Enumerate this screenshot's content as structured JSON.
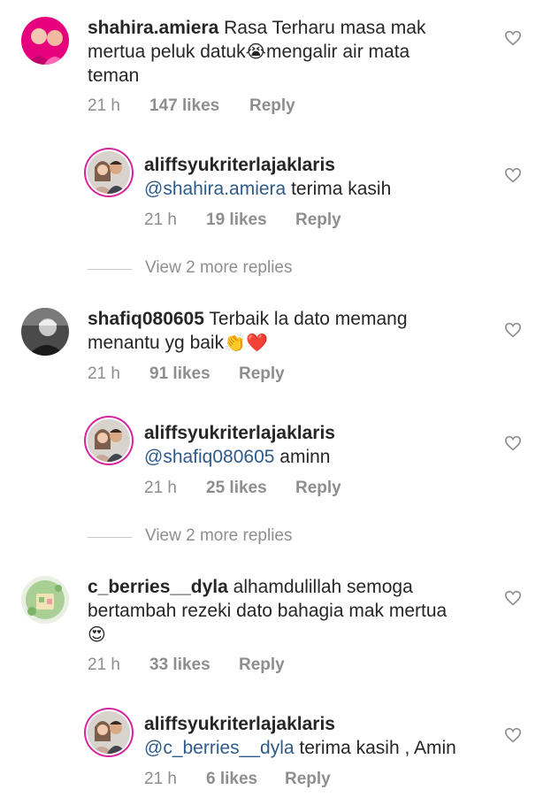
{
  "comments": [
    {
      "username": "shahira.amiera",
      "text_line1": "Rasa Terharu masa mak",
      "text_line2": "mertua peluk datuk",
      "emoji2": "😭",
      "text_line2b": "mengalir air mata",
      "text_line3": "teman",
      "time": "21 h",
      "likes": "147 likes",
      "reply": "Reply",
      "avatar_colors": [
        "#e6007e",
        "#f4c2c2"
      ]
    },
    {
      "username": "shafiq080605",
      "text_line1": "Terbaik la dato memang",
      "text_line2": "menantu yg baik",
      "emoji2": "👏❤️",
      "time": "21 h",
      "likes": "91 likes",
      "reply": "Reply",
      "avatar_colors": [
        "#3a3a3a",
        "#b0b0b0"
      ]
    },
    {
      "username": "c_berries__dyla",
      "text_line1": "alhamdulillah semoga",
      "text_line2": "bertambah rezeki dato bahagia mak mertua",
      "text_line3": "😍",
      "time": "21 h",
      "likes": "33 likes",
      "reply": "Reply",
      "avatar_colors": [
        "#9bc48f",
        "#f0e4c8"
      ]
    }
  ],
  "replies": [
    {
      "username": "aliffsyukriterlajaklaris",
      "mention": "@shahira.amiera",
      "text": "terima kasih",
      "time": "21 h",
      "likes": "19 likes",
      "reply": "Reply"
    },
    {
      "username": "aliffsyukriterlajaklaris",
      "mention": "@shafiq080605",
      "text": "aminn",
      "time": "21 h",
      "likes": "25 likes",
      "reply": "Reply"
    },
    {
      "username": "aliffsyukriterlajaklaris",
      "mention": "@c_berries__dyla",
      "text": "terima kasih , Amin",
      "time": "21 h",
      "likes": "6 likes",
      "reply": "Reply"
    }
  ],
  "view_more": [
    {
      "label": "View 2 more replies"
    },
    {
      "label": "View 2 more replies"
    }
  ],
  "icons": {
    "like": "heart-outline-icon",
    "avatar": "profile-photo"
  },
  "colors": {
    "text": "#262626",
    "meta": "#8e8e8e",
    "mention": "#2e5a8a",
    "story_ring": "#d6249f"
  }
}
